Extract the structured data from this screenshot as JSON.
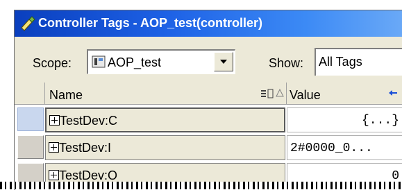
{
  "window": {
    "title": "Controller Tags - AOP_test(controller)"
  },
  "toolbar": {
    "scope_label": "Scope:",
    "scope_value": "AOP_test",
    "show_label": "Show:",
    "show_value": "All Tags"
  },
  "grid": {
    "columns": {
      "name": "Name",
      "value": "Value"
    },
    "rows": [
      {
        "name": "TestDev:C",
        "value": "{...}",
        "selected": true
      },
      {
        "name": "TestDev:I",
        "value": "2#0000_0...",
        "selected": false
      },
      {
        "name": "TestDev:O",
        "value": "0",
        "selected": false
      }
    ]
  }
}
